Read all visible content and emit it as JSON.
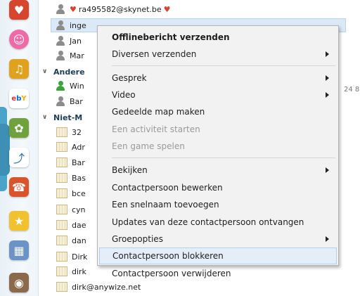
{
  "contacts_top": [
    {
      "label": "ra495582@skynet.be",
      "type": "person"
    },
    {
      "label": "inge",
      "type": "person"
    },
    {
      "label": "Jan",
      "type": "person"
    },
    {
      "label": "Mar",
      "type": "person"
    }
  ],
  "group_anderen": {
    "label": "Andere"
  },
  "contacts_anderen": [
    {
      "label": "Win",
      "type": "person-online"
    },
    {
      "label": "Bar",
      "type": "person"
    }
  ],
  "group_niet": {
    "label": "Niet-M"
  },
  "contacts_niet": [
    {
      "label": "32"
    },
    {
      "label": "Adr"
    },
    {
      "label": "Bar"
    },
    {
      "label": "Bas"
    },
    {
      "label": "bce"
    },
    {
      "label": "cyn"
    },
    {
      "label": "dae"
    },
    {
      "label": "dan"
    },
    {
      "label": "Dirk"
    },
    {
      "label": "dirk"
    },
    {
      "label": "dirk@anywize.net"
    }
  ],
  "right_number": "24 8",
  "menu": {
    "items": [
      {
        "label": "Offlinebericht verzenden",
        "bold": true,
        "submenu": false,
        "disabled": false
      },
      {
        "label": "Diversen verzenden",
        "bold": false,
        "submenu": true,
        "disabled": false
      },
      {
        "label": "Gesprek",
        "bold": false,
        "submenu": true,
        "disabled": false
      },
      {
        "label": "Video",
        "bold": false,
        "submenu": true,
        "disabled": false
      },
      {
        "label": "Gedeelde map maken",
        "bold": false,
        "submenu": false,
        "disabled": false
      },
      {
        "label": "Een activiteit starten",
        "bold": false,
        "submenu": false,
        "disabled": true
      },
      {
        "label": "Een game spelen",
        "bold": false,
        "submenu": false,
        "disabled": true
      },
      {
        "label": "Bekijken",
        "bold": false,
        "submenu": true,
        "disabled": false
      },
      {
        "label": "Contactpersoon bewerken",
        "bold": false,
        "submenu": false,
        "disabled": false
      },
      {
        "label": "Een snelnaam toevoegen",
        "bold": false,
        "submenu": false,
        "disabled": false
      },
      {
        "label": "Updates van deze contactpersoon ontvangen",
        "bold": false,
        "submenu": false,
        "disabled": false
      },
      {
        "label": "Groepopties",
        "bold": false,
        "submenu": true,
        "disabled": false
      },
      {
        "label": "Contactpersoon blokkeren",
        "bold": false,
        "submenu": false,
        "disabled": false,
        "hover": true
      },
      {
        "label": "Contactpersoon verwijderen",
        "bold": false,
        "submenu": false,
        "disabled": false
      }
    ]
  },
  "sidebar_icons": [
    "heart-face-icon",
    "smiley-icon",
    "music-player-icon",
    "ebay-icon",
    "frog-icon",
    "stats-icon",
    "phone-icon",
    "star-icon",
    "calendar-icon",
    "globe-icon"
  ],
  "colors": {
    "online": "#3aa43a",
    "offline": "#8c8c8c",
    "accent": "#4aa3c8",
    "menu_hover": "#e4eef8"
  }
}
